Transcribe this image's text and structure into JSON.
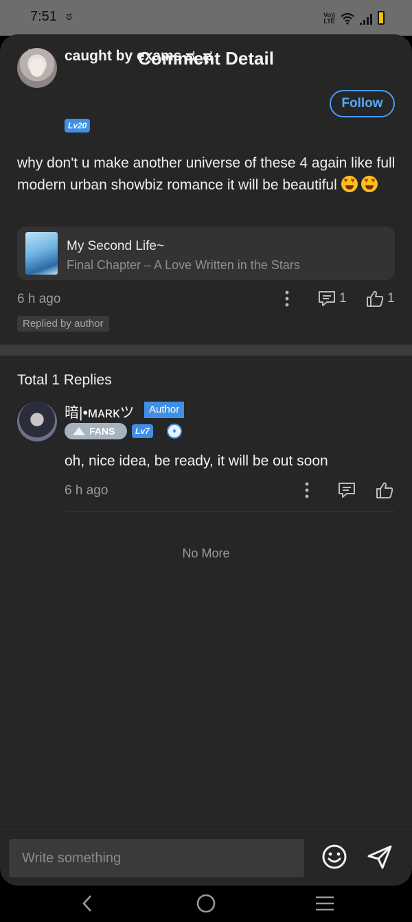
{
  "status_bar": {
    "time": "7:51",
    "notification_glyph": "ಠ",
    "volte": [
      "Vo))",
      "LTE"
    ]
  },
  "header": {
    "title": "Comment Detail"
  },
  "comment": {
    "username": "caught by exams ಥ_ಥ",
    "level": "Lv20",
    "follow_label": "Follow",
    "text": "why don't u make another universe of these 4 again like full modern urban showbiz romance it will be beautiful",
    "book": {
      "title": "My Second Life~",
      "chapter": "Final Chapter – A Love Written in the Stars"
    },
    "time": "6 h ago",
    "reply_count": "1",
    "like_count": "1",
    "replied_badge": "Replied by author"
  },
  "replies": {
    "heading": "Total 1 Replies",
    "items": [
      {
        "username": "暗|•ᴍᴀʀᴋツ",
        "author_badge": "Author",
        "fans_badge": "FANS",
        "level": "Lv7",
        "text": "oh, nice idea, be ready, it will be out soon",
        "time": "6 h ago"
      }
    ],
    "end_text": "No More"
  },
  "composer": {
    "placeholder": "Write something"
  },
  "colors": {
    "accent": "#3f8fe6",
    "background": "#262626",
    "card": "#333333"
  }
}
